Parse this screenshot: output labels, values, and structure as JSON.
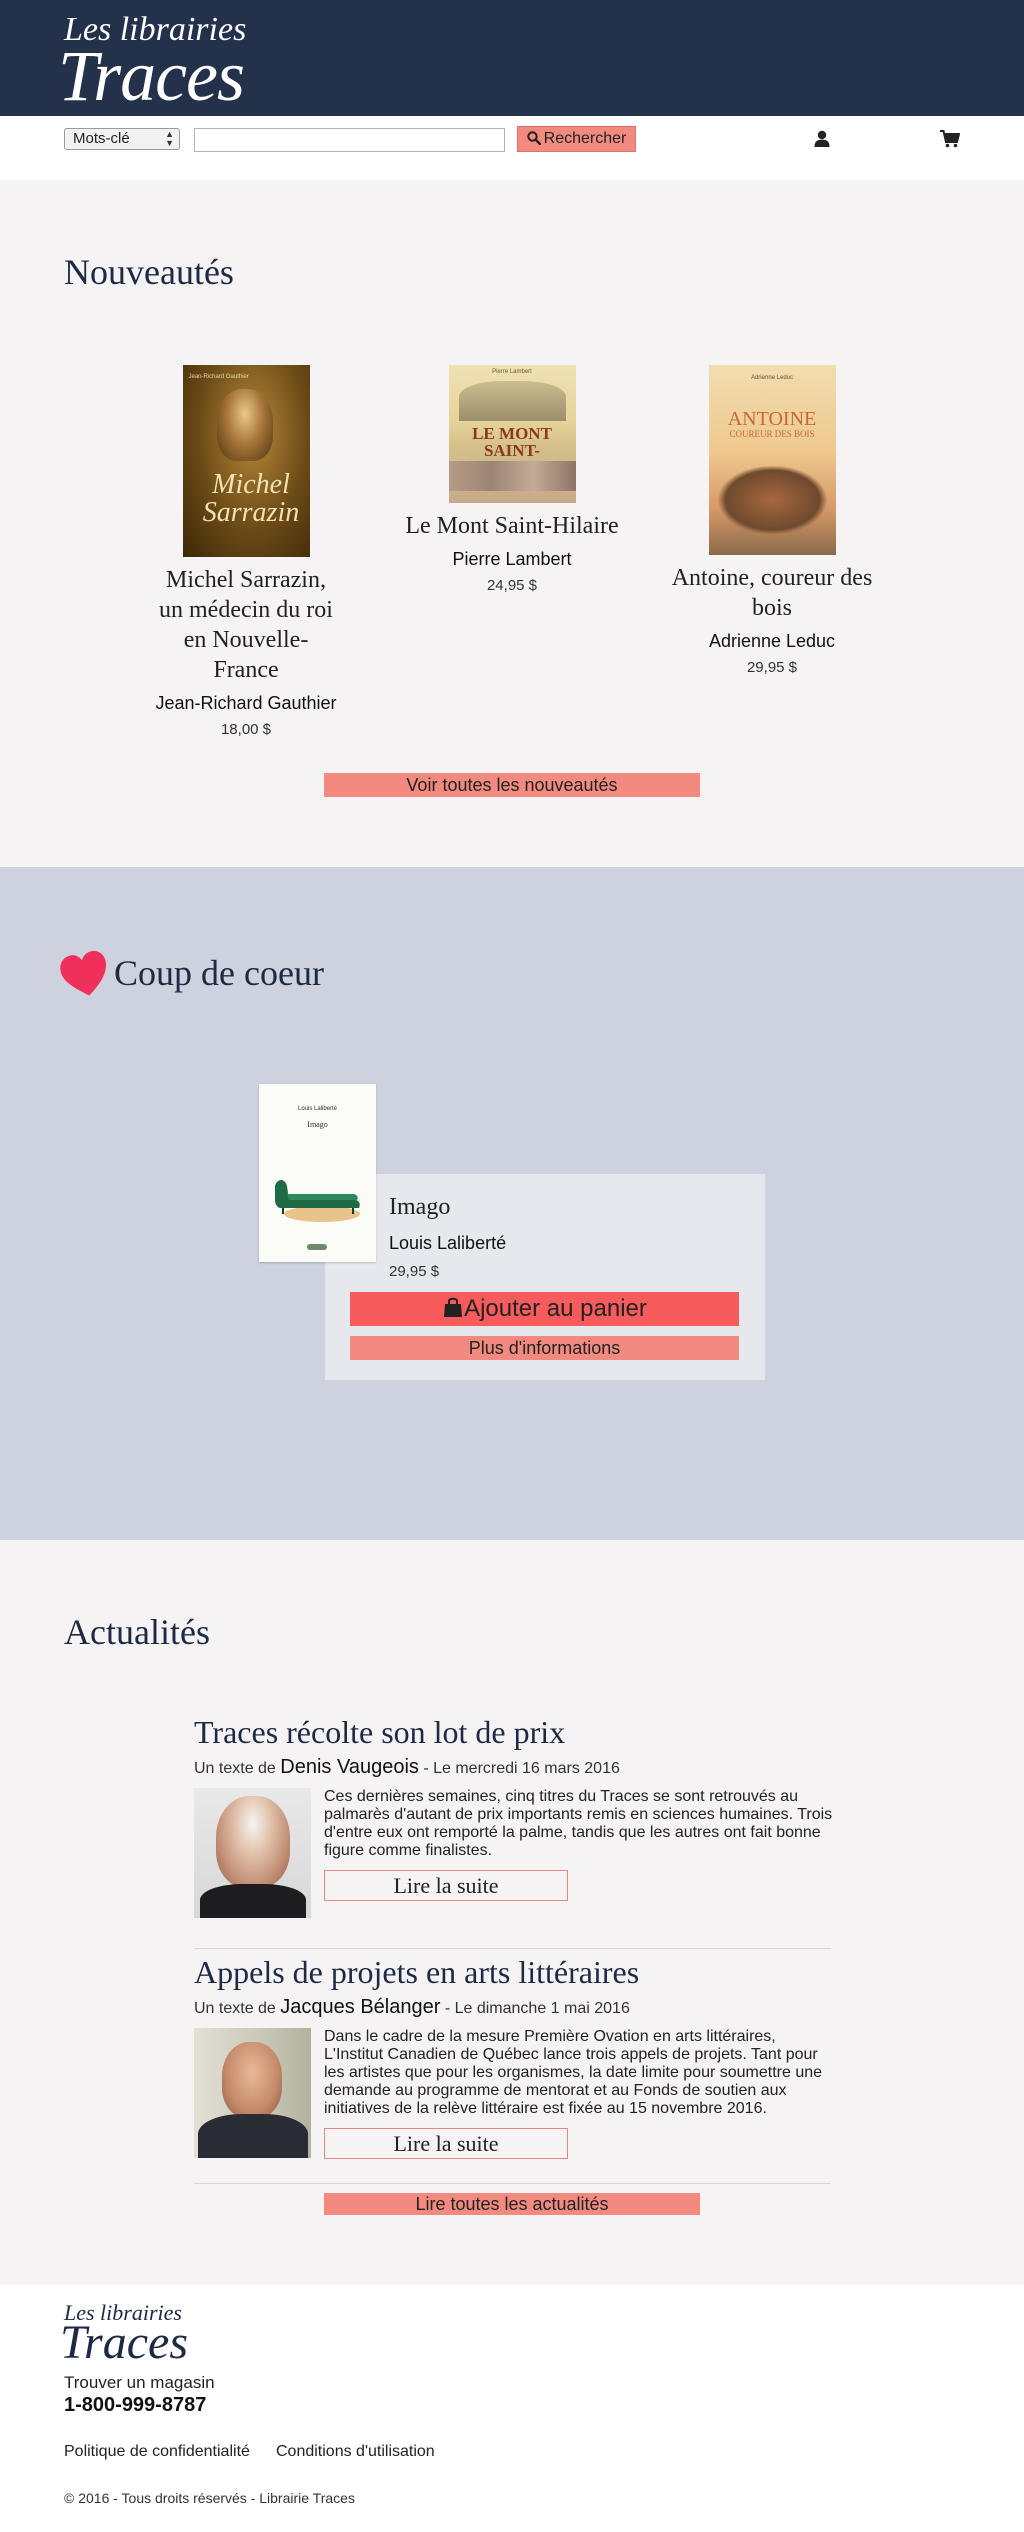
{
  "header": {
    "logo_top": "Les librairies",
    "logo_main": "Traces",
    "colors": {
      "header_bg": "#23314a",
      "accent": "#f38a80",
      "add_to_cart": "#f85b5b",
      "coup_bg": "#cdd2de"
    }
  },
  "search": {
    "select_value": "Mots-clé",
    "input_value": "",
    "button_label": "Rechercher",
    "button_icon": "search-icon",
    "user_icon": "user-icon",
    "cart_icon": "cart-icon"
  },
  "nouveautes": {
    "title": "Nouveautés",
    "books": [
      {
        "title": "Michel Sarrazin, un médecin du roi en Nouvelle-France",
        "author": "Jean-Richard Gauthier",
        "price": "18,00 $",
        "cover_author": "Jean-Richard Gauthier",
        "cover_title": "Michel Sarrazin"
      },
      {
        "title": "Le Mont Saint-Hilaire",
        "author": "Pierre Lambert",
        "price": "24,95 $",
        "cover_author": "Pierre Lambert",
        "cover_title": "LE MONT SAINT-HILAIRE"
      },
      {
        "title": "Antoine, coureur des bois",
        "author": "Adrienne Leduc",
        "price": "29,95 $",
        "cover_author": "Adrienne Leduc",
        "cover_title": "ANTOINE",
        "cover_subtitle": "COUREUR DES BOIS"
      }
    ],
    "see_all": "Voir toutes les nouveautés"
  },
  "coup_de_coeur": {
    "title": "Coup de coeur",
    "icon": "heart-icon",
    "book": {
      "title": "Imago",
      "author": "Louis Laliberté",
      "price": "29,95 $",
      "cover_author": "Louis Laliberté",
      "cover_title": "Imago"
    },
    "add_to_cart": "Ajouter au panier",
    "add_icon": "shopping-bag-icon",
    "more_info": "Plus d'informations"
  },
  "actualites": {
    "title": "Actualités",
    "articles": [
      {
        "title": "Traces récolte son lot de prix",
        "prefix": "Un texte de ",
        "author": "Denis Vaugeois",
        "date": " - Le mercredi 16 mars 2016",
        "excerpt": "Ces dernières semaines, cinq titres du Traces se sont retrouvés au palmarès d'autant de prix importants remis en sciences humaines. Trois d'entre eux ont remporté la palme, tandis que les autres ont fait bonne figure comme finalistes.",
        "read_more": "Lire la suite"
      },
      {
        "title": "Appels de projets en arts littéraires",
        "prefix": "Un texte de ",
        "author": "Jacques Bélanger",
        "date": " - Le dimanche 1 mai 2016",
        "excerpt": "Dans le cadre de la mesure Première Ovation en arts littéraires, L'Institut Canadien de Québec lance trois appels de projets. Tant pour les artistes que pour les organismes, la date limite pour soumettre une demande au programme de mentorat et au Fonds de soutien aux initiatives de la relève littéraire est fixée au 15 novembre 2016.",
        "read_more": "Lire la suite"
      }
    ],
    "read_all": "Lire toutes les actualités"
  },
  "footer": {
    "logo_top": "Les librairies",
    "logo_main": "Traces",
    "find_store": "Trouver un magasin",
    "phone": "1-800-999-8787",
    "privacy": "Politique de confidentialité",
    "terms": "Conditions d'utilisation",
    "copyright": "© 2016 - Tous droits réservés - Librairie Traces"
  }
}
